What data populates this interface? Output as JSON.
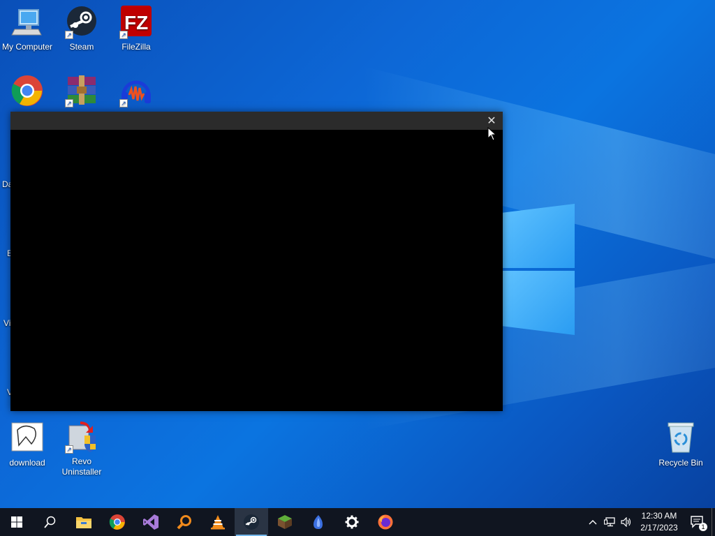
{
  "desktop": {
    "icons": [
      {
        "label": "My Computer"
      },
      {
        "label": "Steam"
      },
      {
        "label": "FileZilla"
      },
      {
        "label": ""
      },
      {
        "label": ""
      },
      {
        "label": ""
      },
      {
        "label": "download"
      },
      {
        "label": "Revo Uninstaller"
      },
      {
        "label": "Recycle Bin"
      }
    ],
    "partial_labels": [
      "Da",
      "E",
      "Vi",
      "V"
    ]
  },
  "window": {
    "title": "",
    "close_glyph": "✕"
  },
  "taskbar": {
    "apps": [
      {
        "icon": "windows-start-icon"
      },
      {
        "icon": "search-icon"
      },
      {
        "icon": "file-explorer-icon"
      },
      {
        "icon": "chrome-icon"
      },
      {
        "icon": "visual-studio-icon"
      },
      {
        "icon": "search-tool-icon"
      },
      {
        "icon": "vlc-icon"
      },
      {
        "icon": "steam-icon",
        "active": true
      },
      {
        "icon": "minecraft-icon"
      },
      {
        "icon": "app-icon"
      },
      {
        "icon": "settings-icon"
      },
      {
        "icon": "firefox-icon"
      }
    ],
    "tray": {
      "chevron": "^",
      "time": "12:30 AM",
      "date": "2/17/2023",
      "notification_count": "1"
    }
  },
  "colors": {
    "accent": "#76b9ed",
    "taskbar_bg": "#101520",
    "window_titlebar": "#2b2b2b"
  }
}
